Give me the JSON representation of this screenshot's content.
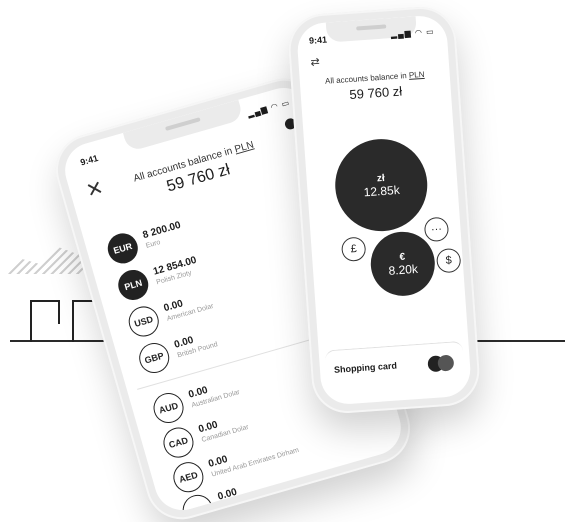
{
  "status_time": "9:41",
  "phone1": {
    "balance_label_prefix": "All accounts balance in",
    "balance_currency": "PLN",
    "balance_value": "59 760 zł",
    "accounts": [
      {
        "code": "EUR",
        "amount": "8 200.00",
        "name": "Euro",
        "style": "dark"
      },
      {
        "code": "PLN",
        "amount": "12 854.00",
        "name": "Polish Zloty",
        "style": "dark"
      },
      {
        "code": "USD",
        "amount": "0.00",
        "name": "American Dolar",
        "style": "light"
      },
      {
        "code": "GBP",
        "amount": "0.00",
        "name": "British Pound",
        "style": "light"
      },
      {
        "code": "AUD",
        "amount": "0.00",
        "name": "Australian Dolar",
        "style": "light"
      },
      {
        "code": "CAD",
        "amount": "0.00",
        "name": "Canadian Dolar",
        "style": "light"
      },
      {
        "code": "AED",
        "amount": "0.00",
        "name": "United Arab Emirates Dirham",
        "style": "light"
      }
    ],
    "partial_row_amount": "0.00"
  },
  "phone2": {
    "balance_label_prefix": "All accounts balance in",
    "balance_currency": "PLN",
    "balance_value": "59 760 zł",
    "bubbles": {
      "pln_symbol": "zł",
      "pln_value": "12.85k",
      "eur_symbol": "€",
      "eur_value": "8.20k",
      "gbp_symbol": "£",
      "usd_symbol": "$",
      "more_symbol": "···"
    },
    "card_label": "Shopping card"
  }
}
